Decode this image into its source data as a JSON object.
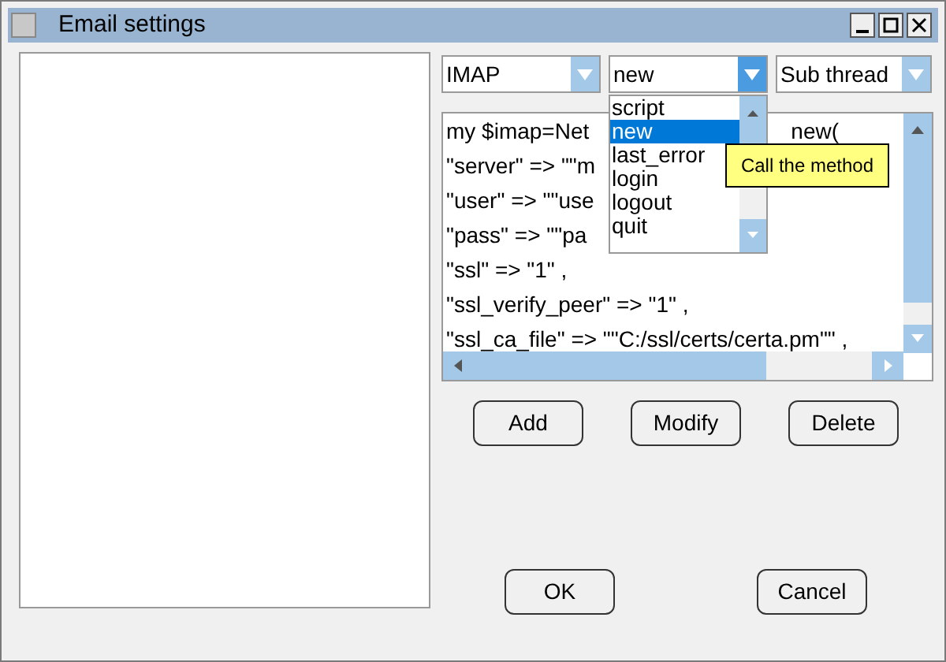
{
  "window": {
    "title": "Email settings"
  },
  "combos": [
    {
      "value": "IMAP",
      "open": false
    },
    {
      "value": "new",
      "open": true
    },
    {
      "value": "Sub thread",
      "open": false
    }
  ],
  "code_lines": [
    {
      "text": "my $imap=Net",
      "tail": "new("
    },
    {
      "text": "\"server\" => \"\"m"
    },
    {
      "text": "\"user\" => \"\"use"
    },
    {
      "text": "\"pass\" => \"\"pa"
    },
    {
      "text": "\"ssl\" => \"1\" ,"
    },
    {
      "text": "\"ssl_verify_peer\" => \"1\" ,"
    },
    {
      "text": "\"ssl_ca_file\" => \"\"C:/ssl/certs/certa.pm\"\" ,"
    }
  ],
  "dropdown": {
    "items": [
      {
        "label": "script",
        "selected": false
      },
      {
        "label": "new",
        "selected": true
      },
      {
        "label": "last_error",
        "selected": false
      },
      {
        "label": "login",
        "selected": false
      },
      {
        "label": "logout",
        "selected": false
      },
      {
        "label": "quit",
        "selected": false
      }
    ]
  },
  "tooltip": "Call the method",
  "buttons": [
    "Add",
    "Modify",
    "Delete"
  ],
  "dialog_buttons": [
    "OK",
    "Cancel"
  ]
}
